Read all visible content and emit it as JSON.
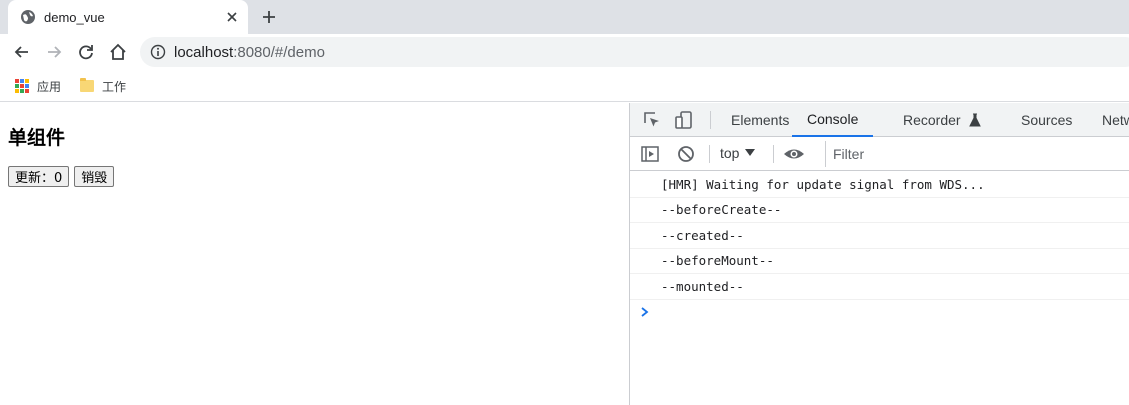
{
  "browser": {
    "tab_title": "demo_vue",
    "url_host": "localhost",
    "url_rest": ":8080/#/demo",
    "bookmarks": [
      "应用",
      "工作"
    ]
  },
  "page": {
    "heading": "单组件",
    "update_button": "更新：0",
    "destroy_button": "销毁"
  },
  "devtools": {
    "tabs": [
      "Elements",
      "Console",
      "Recorder",
      "Sources",
      "Netw"
    ],
    "active_tab": "Console",
    "context": "top",
    "filter_placeholder": "Filter",
    "logs": [
      "[HMR] Waiting for update signal from WDS...",
      "--beforeCreate--",
      "--created--",
      "--beforeMount--",
      "--mounted--"
    ],
    "accent": "#1a73e8"
  }
}
